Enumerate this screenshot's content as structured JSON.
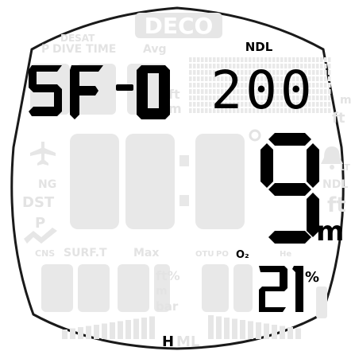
{
  "display": {
    "deco_label": "DECO",
    "desat_label": "DESAT",
    "dive_time_label": "DIVE TIME",
    "avg_label": "Avg",
    "p_label": "P",
    "ndl_label": "NDL",
    "ndl_value": "200",
    "sf_text": "SF -0",
    "depth_value": "9",
    "depth_unit": "m",
    "ng_label": "NG",
    "dst_label": "DST",
    "p2_label": "P",
    "lt_label": "LT",
    "ndl2_label": "NDL",
    "ft_label": "ft",
    "m_label": "m",
    "cns_label": "CNS",
    "surft_label": "SURF.T",
    "max_label": "Max",
    "otu_label": "OTU",
    "po2_label": "PO",
    "o2_label": "O₂",
    "he_label": "He",
    "ft_pct_label": "ft%",
    "bar_label": "bar",
    "o2_value": "21",
    "percent": "%",
    "h_label": "H",
    "ml_label": "ML"
  }
}
